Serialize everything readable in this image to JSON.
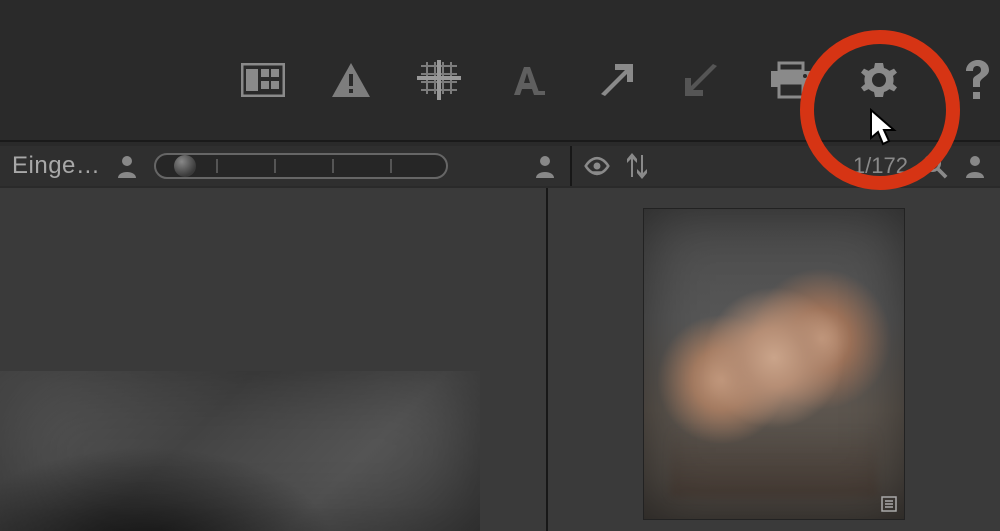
{
  "toolbar": {
    "items": [
      {
        "name": "view-mode-icon"
      },
      {
        "name": "warning-icon"
      },
      {
        "name": "grid-icon"
      },
      {
        "name": "text-icon"
      },
      {
        "name": "arrow-up-right-icon"
      },
      {
        "name": "arrow-down-left-icon"
      },
      {
        "name": "print-icon"
      },
      {
        "name": "gear-icon"
      },
      {
        "name": "help-icon"
      }
    ]
  },
  "left_panel": {
    "label": "Einge…"
  },
  "right_panel": {
    "counter": "1/172"
  },
  "thumbnails": {
    "left_alt": "image-preview",
    "right_alt": "image-thumbnail"
  }
}
